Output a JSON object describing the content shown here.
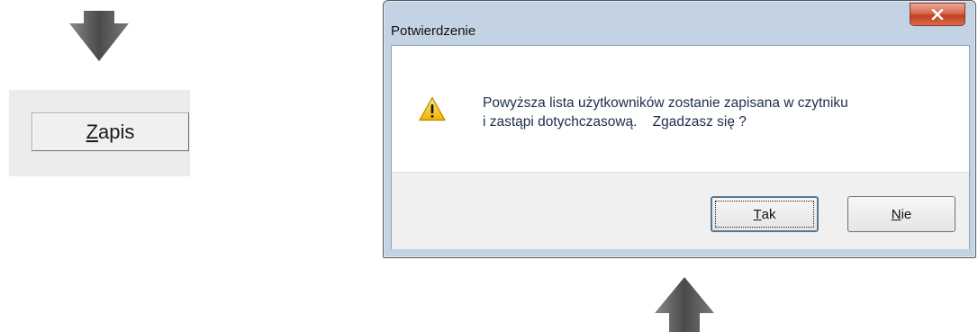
{
  "zapis_button": {
    "mnemonic": "Z",
    "rest": "apis"
  },
  "dialog": {
    "title": "Potwierdzenie",
    "close_label": "X",
    "icon": "warning-icon",
    "message": {
      "line1": "Powyższa lista użytkowników zostanie zapisana w czytniku",
      "line2": "i zastąpi dotychczasową.    Zgadzasz się ?"
    },
    "buttons": {
      "yes": {
        "mnemonic": "T",
        "rest": "ak"
      },
      "no": {
        "mnemonic": "N",
        "rest": "ie"
      }
    }
  },
  "colors": {
    "arrow": "#5f5f5f",
    "close_button": "#c7472a",
    "warning": "#f5c400",
    "dialog_frame": "#c4d3e3"
  }
}
